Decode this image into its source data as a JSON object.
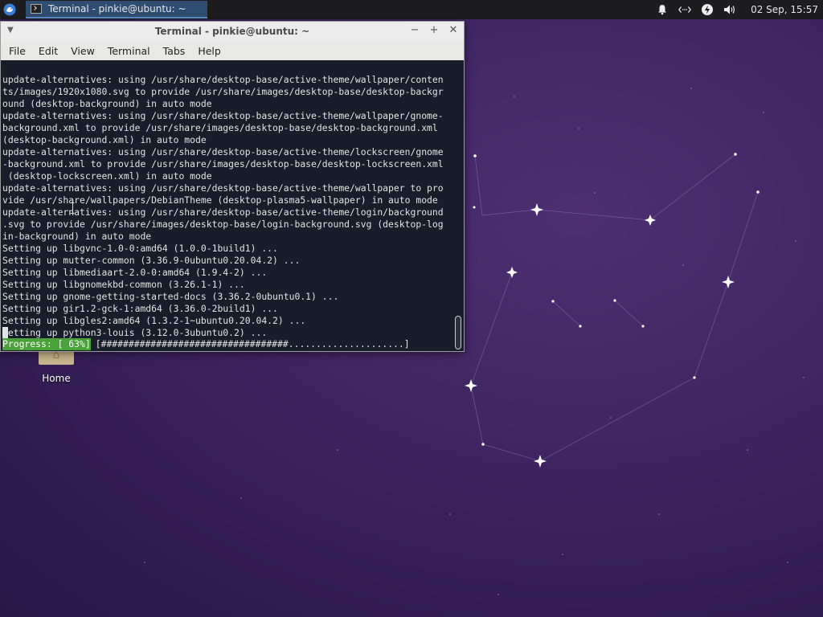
{
  "panel": {
    "task_title": "Terminal - pinkie@ubuntu: ~",
    "clock": "02 Sep, 15:57",
    "icons": [
      "xfce-whisker-icon",
      "terminal-icon",
      "notification-bell-icon",
      "network-icon",
      "power-icon",
      "volume-icon"
    ]
  },
  "desktop": {
    "home_label": "Home"
  },
  "window": {
    "title": "Terminal - pinkie@ubuntu: ~",
    "menu": [
      "File",
      "Edit",
      "View",
      "Terminal",
      "Tabs",
      "Help"
    ]
  },
  "terminal": {
    "lines": [
      "update-alternatives: using /usr/share/desktop-base/active-theme/wallpaper/conten",
      "ts/images/1920x1080.svg to provide /usr/share/images/desktop-base/desktop-backgr",
      "ound (desktop-background) in auto mode",
      "update-alternatives: using /usr/share/desktop-base/active-theme/wallpaper/gnome-",
      "background.xml to provide /usr/share/images/desktop-base/desktop-background.xml",
      "(desktop-background.xml) in auto mode",
      "update-alternatives: using /usr/share/desktop-base/active-theme/lockscreen/gnome",
      "-background.xml to provide /usr/share/images/desktop-base/desktop-lockscreen.xml",
      " (desktop-lockscreen.xml) in auto mode",
      "update-alternatives: using /usr/share/desktop-base/active-theme/wallpaper to pro",
      "vide /usr/share/wallpapers/DebianTheme (desktop-plasma5-wallpaper) in auto mode",
      "update-alternatives: using /usr/share/desktop-base/active-theme/login/background",
      ".svg to provide /usr/share/images/desktop-base/login-background.svg (desktop-log",
      "in-background) in auto mode",
      "Setting up libgvnc-1.0-0:amd64 (1.0.0-1build1) ...",
      "Setting up mutter-common (3.36.9-0ubuntu0.20.04.2) ...",
      "Setting up libmediaart-2.0-0:amd64 (1.9.4-2) ...",
      "Setting up libgnomekbd-common (3.26.1-1) ...",
      "Setting up gnome-getting-started-docs (3.36.2-0ubuntu0.1) ...",
      "Setting up gir1.2-gck-1:amd64 (3.36.0-2build1) ...",
      "Setting up libgles2:amd64 (1.3.2-1~ubuntu0.20.04.2) ...",
      "Setting up python3-louis (3.12.0-3ubuntu0.2) ..."
    ],
    "progress_label": "Progress: [ 63%]",
    "progress_bar": "[##################################.....................]",
    "progress_percent": 63
  },
  "colors": {
    "terminal_bg": "#171e29",
    "progress_green": "#4aa23a",
    "panel_bg": "#1d1d1f",
    "task_active": "#2f4d70"
  }
}
